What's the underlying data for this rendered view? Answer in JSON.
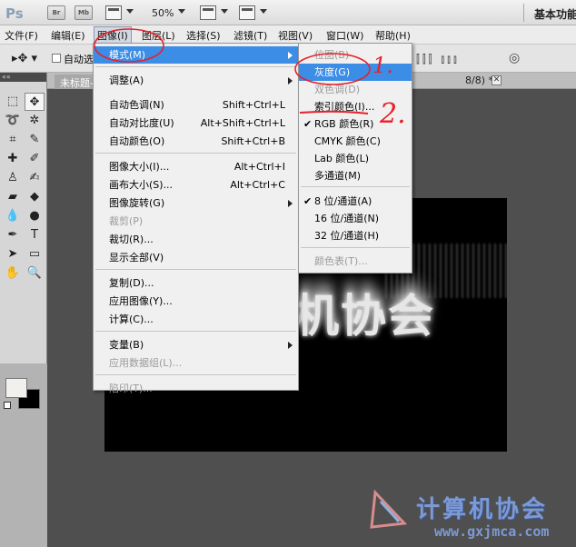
{
  "appbar": {
    "logo": "Ps",
    "bridge_label": "Br",
    "minibridge_label": "Mb",
    "zoom": "50%",
    "workspace": "基本功能"
  },
  "menubar": {
    "items": [
      "文件(F)",
      "编辑(E)",
      "图像(I)",
      "图层(L)",
      "选择(S)",
      "滤镜(T)",
      "视图(V)",
      "窗口(W)",
      "帮助(H)"
    ]
  },
  "options": {
    "auto_select_label": "自动选"
  },
  "document": {
    "tab_label": "未标题-",
    "tab_suffix": "8/8) *",
    "close_glyph": "✕",
    "canvas_text": "机协会"
  },
  "image_menu": {
    "items": [
      {
        "label": "模式(M)",
        "shortcut": "",
        "submenu": true,
        "disabled": false,
        "highlight": true
      },
      {
        "label": "调整(A)",
        "shortcut": "",
        "submenu": true,
        "disabled": false
      },
      {
        "label": "自动色调(N)",
        "shortcut": "Shift+Ctrl+L",
        "disabled": false
      },
      {
        "label": "自动对比度(U)",
        "shortcut": "Alt+Shift+Ctrl+L",
        "disabled": false
      },
      {
        "label": "自动颜色(O)",
        "shortcut": "Shift+Ctrl+B",
        "disabled": false
      },
      {
        "label": "图像大小(I)...",
        "shortcut": "Alt+Ctrl+I",
        "disabled": false
      },
      {
        "label": "画布大小(S)...",
        "shortcut": "Alt+Ctrl+C",
        "disabled": false
      },
      {
        "label": "图像旋转(G)",
        "shortcut": "",
        "submenu": true,
        "disabled": false
      },
      {
        "label": "裁剪(P)",
        "shortcut": "",
        "disabled": true
      },
      {
        "label": "裁切(R)...",
        "shortcut": "",
        "disabled": false
      },
      {
        "label": "显示全部(V)",
        "shortcut": "",
        "disabled": false
      },
      {
        "label": "复制(D)...",
        "shortcut": "",
        "disabled": false
      },
      {
        "label": "应用图像(Y)...",
        "shortcut": "",
        "disabled": false
      },
      {
        "label": "计算(C)...",
        "shortcut": "",
        "disabled": false
      },
      {
        "label": "变量(B)",
        "shortcut": "",
        "submenu": true,
        "disabled": false
      },
      {
        "label": "应用数据组(L)...",
        "shortcut": "",
        "disabled": true
      },
      {
        "label": "陷印(T)...",
        "shortcut": "",
        "disabled": true
      }
    ]
  },
  "mode_menu": {
    "items": [
      {
        "label": "位图(B)",
        "disabled": true,
        "checked": false
      },
      {
        "label": "灰度(G)",
        "disabled": false,
        "checked": false,
        "highlight": true
      },
      {
        "label": "双色调(D)",
        "disabled": true,
        "checked": false
      },
      {
        "label": "索引颜色(I)...",
        "disabled": false,
        "checked": false
      },
      {
        "label": "RGB 颜色(R)",
        "disabled": false,
        "checked": true
      },
      {
        "label": "CMYK 颜色(C)",
        "disabled": false,
        "checked": false
      },
      {
        "label": "Lab 颜色(L)",
        "disabled": false,
        "checked": false
      },
      {
        "label": "多通道(M)",
        "disabled": false,
        "checked": false
      },
      {
        "label": "8 位/通道(A)",
        "disabled": false,
        "checked": true
      },
      {
        "label": "16 位/通道(N)",
        "disabled": false,
        "checked": false
      },
      {
        "label": "32 位/通道(H)",
        "disabled": false,
        "checked": false
      },
      {
        "label": "颜色表(T)...",
        "disabled": true,
        "checked": false
      }
    ],
    "check_glyph": "✔"
  },
  "annotations": {
    "step1": "1.",
    "step2": "2."
  },
  "watermark": {
    "title": "计算机协会",
    "url": "www.gxjmca.com"
  },
  "colors": {
    "highlight": "#3b8de6",
    "annotation": "#e8202a",
    "watermark": "#7b9ad6"
  }
}
